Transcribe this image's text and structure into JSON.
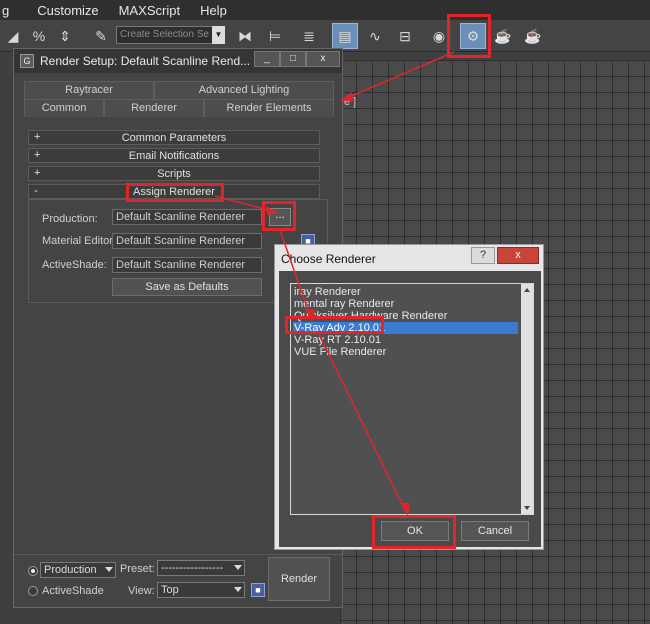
{
  "menubar": {
    "items": [
      "g",
      "Customize",
      "MAXScript",
      "Help"
    ]
  },
  "toolbar": {
    "selection_set_placeholder": "Create Selection Se",
    "icons": [
      "percent-snap-icon",
      "spinner-snap-icon",
      "edit-named-selection-icon",
      "mirror-icon",
      "align-icon",
      "layer-manager-icon",
      "scene-explorer-icon",
      "curve-editor-icon",
      "schematic-view-icon",
      "material-editor-icon",
      "render-setup-icon",
      "rendered-frame-window-icon",
      "render-production-icon"
    ]
  },
  "viewport": {
    "label": "e ]"
  },
  "render_setup": {
    "title": "Render Setup: Default Scanline Rend...",
    "controls": {
      "minimize": "_",
      "maximize": "□",
      "close": "x"
    },
    "tabs_top": [
      "Raytracer",
      "Advanced Lighting"
    ],
    "tabs_bottom": [
      "Common",
      "Renderer",
      "Render Elements"
    ],
    "rollouts": [
      {
        "sign": "+",
        "label": "Common Parameters"
      },
      {
        "sign": "+",
        "label": "Email Notifications"
      },
      {
        "sign": "+",
        "label": "Scripts"
      },
      {
        "sign": "-",
        "label": "Assign Renderer"
      }
    ],
    "fields": {
      "production_label": "Production:",
      "production_value": "Default Scanline Renderer",
      "material_label": "Material Editor:",
      "material_value": "Default Scanline Renderer",
      "activeshade_label": "ActiveShade:",
      "activeshade_value": "Default Scanline Renderer",
      "ellipsis": "..."
    },
    "save_defaults": "Save as Defaults",
    "bottom": {
      "production_dropdown": "Production",
      "preset_label": "Preset:",
      "preset_value": "-----------------",
      "activeshade_label": "ActiveShade",
      "view_label": "View:",
      "view_value": "Top",
      "render_button": "Render"
    }
  },
  "choose_renderer": {
    "title": "Choose Renderer",
    "help": "?",
    "close": "x",
    "items": [
      "iray Renderer",
      "mental ray Renderer",
      "Quicksilver Hardware Renderer",
      "V-Ray Adv 2.10.01",
      "V-Ray RT 2.10.01",
      "VUE File Renderer"
    ],
    "selected_index": 3,
    "ok": "OK",
    "cancel": "Cancel"
  },
  "colors": {
    "highlight": "#e0262b",
    "selection": "#3d7bd1"
  }
}
